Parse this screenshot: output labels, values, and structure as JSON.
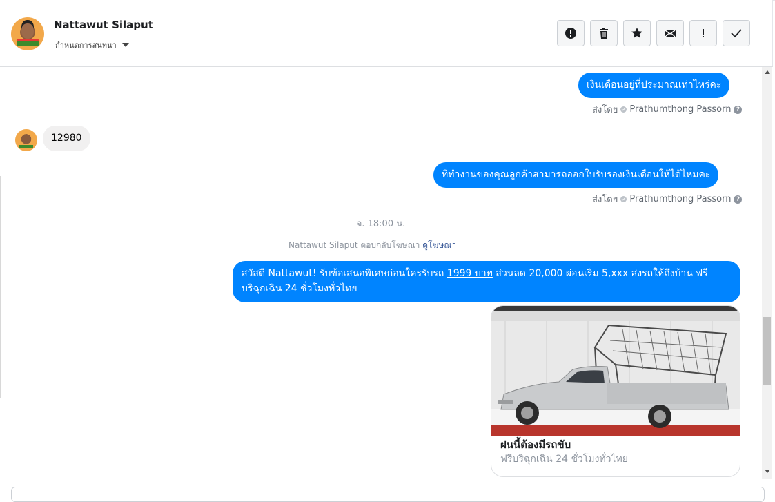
{
  "contact": {
    "name": "Nattawut Silaput",
    "label_dropdown": "กำหนดการสนทนา"
  },
  "toolbar": {
    "buttons": [
      {
        "name": "report-spam-button",
        "icon": "alert-circle-icon"
      },
      {
        "name": "delete-button",
        "icon": "trash-icon"
      },
      {
        "name": "star-button",
        "icon": "star-icon"
      },
      {
        "name": "mark-unread-button",
        "icon": "envelope-icon"
      },
      {
        "name": "follow-up-button",
        "icon": "exclamation-icon"
      },
      {
        "name": "mark-done-button",
        "icon": "checkmark-icon"
      }
    ]
  },
  "messages": {
    "m1": {
      "text": "เงินเดือนอยู่ที่ประมาณเท่าไหร่คะ"
    },
    "m1_sent_prefix": "ส่งโดย",
    "m1_sender": "Prathumthong Passorn",
    "m2": {
      "text": "12980"
    },
    "m3": {
      "text": "ที่ทำงานของคุณลูกค้าสามารถออกใบรับรองเงินเดือนให้ได้ไหมคะ"
    },
    "m3_sent_prefix": "ส่งโดย",
    "m3_sender": "Prathumthong Passorn",
    "timestamp": "จ. 18:00 น.",
    "ad_reply_text": "Nattawut Silaput ตอบกลับโฆษณา",
    "ad_reply_link": "ดูโฆษณา",
    "m4_part1": "สวัสดี Nattawut! รับข้อเสนอพิเศษก่อนใครรับรถ ",
    "m4_link": "1999 บาท",
    "m4_part2": " ส่วนลด 20,000  ผ่อนเริ่ม 5,xxx ส่งรถให้ถึงบ้าน ฟรี",
    "m4_line2": "บริฉุกเฉิน 24 ชั่วโมงทั่วไทย"
  },
  "ad_card": {
    "title": "ฝนนี้ต้องมีรถขับ",
    "subtitle": "ฟรีบริฉุกเฉิน 24 ชั่วโมงทั่วไทย"
  },
  "colors": {
    "outgoing_bubble": "#0084ff",
    "incoming_bubble": "#f1f0f0"
  }
}
